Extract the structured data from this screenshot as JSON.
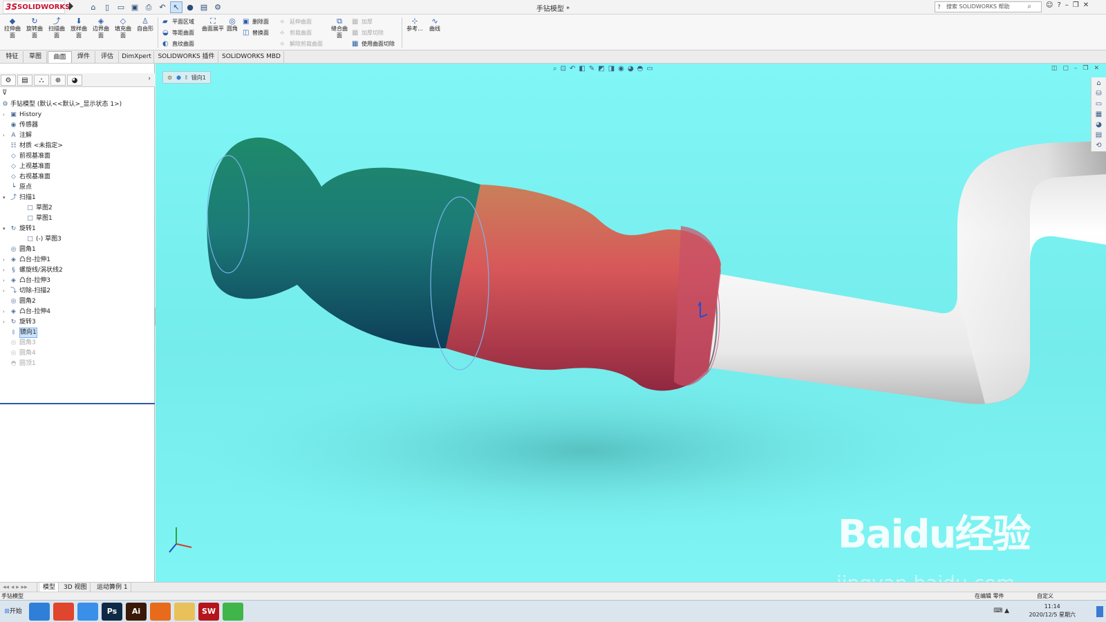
{
  "app": {
    "brand": "SOLIDWORKS",
    "brand_prefix": "3S",
    "doc_title": "手钻模型 *"
  },
  "search": {
    "placeholder": "搜索 SOLIDWORKS 帮助"
  },
  "quick_access": [
    "home-icon",
    "new-icon",
    "open-icon",
    "save-icon",
    "print-icon",
    "undo-icon",
    "select-icon",
    "rebuild-icon",
    "file-props-icon",
    "options-icon"
  ],
  "ribbon": {
    "big_buttons": [
      {
        "label": "拉伸曲面",
        "icon": "extrude-surface-icon"
      },
      {
        "label": "旋转曲面",
        "icon": "revolve-surface-icon"
      },
      {
        "label": "扫描曲面",
        "icon": "sweep-surface-icon"
      },
      {
        "label": "放样曲面",
        "icon": "loft-surface-icon"
      },
      {
        "label": "边界曲面",
        "icon": "boundary-surface-icon"
      },
      {
        "label": "填充曲面",
        "icon": "fill-surface-icon"
      },
      {
        "label": "自由形",
        "icon": "freeform-icon"
      }
    ],
    "col2": [
      "平面区域",
      "等距曲面",
      "直纹曲面"
    ],
    "flatten": "曲面展平",
    "fillet": "圆角",
    "col3": [
      "删除面",
      "替换面"
    ],
    "col4_disabled": [
      "延伸曲面",
      "剪裁曲面",
      "解除剪裁曲面"
    ],
    "knit": "缝合曲面",
    "col5": [
      {
        "label": "加厚",
        "disabled": true
      },
      {
        "label": "加厚切除",
        "disabled": true
      },
      {
        "label": "使用曲面切除",
        "disabled": false
      }
    ],
    "ref": "参考...",
    "curves": "曲线"
  },
  "tabs": [
    {
      "label": "特征",
      "active": false
    },
    {
      "label": "草图",
      "active": false
    },
    {
      "label": "曲面",
      "active": true
    },
    {
      "label": "焊件",
      "active": false
    },
    {
      "label": "评估",
      "active": false
    },
    {
      "label": "DimXpert",
      "active": false
    },
    {
      "label": "SOLIDWORKS 插件",
      "active": false
    },
    {
      "label": "SOLIDWORKS MBD",
      "active": false
    }
  ],
  "tree": {
    "root": "手钻模型 (默认<<默认>_显示状态 1>)",
    "items": [
      {
        "label": "History",
        "icon": "history-icon",
        "indent": 0,
        "arrow": "right"
      },
      {
        "label": "传感器",
        "icon": "sensor-icon",
        "indent": 0,
        "arrow": ""
      },
      {
        "label": "注解",
        "icon": "annotation-icon",
        "indent": 0,
        "arrow": "right"
      },
      {
        "label": "材质 <未指定>",
        "icon": "material-icon",
        "indent": 0,
        "arrow": ""
      },
      {
        "label": "前视基准面",
        "icon": "plane-icon",
        "indent": 0,
        "arrow": ""
      },
      {
        "label": "上视基准面",
        "icon": "plane-icon",
        "indent": 0,
        "arrow": ""
      },
      {
        "label": "右视基准面",
        "icon": "plane-icon",
        "indent": 0,
        "arrow": ""
      },
      {
        "label": "原点",
        "icon": "origin-icon",
        "indent": 0,
        "arrow": ""
      },
      {
        "label": "扫描1",
        "icon": "sweep-icon",
        "indent": 0,
        "arrow": "down"
      },
      {
        "label": "草图2",
        "icon": "sketch-icon",
        "indent": 1,
        "arrow": ""
      },
      {
        "label": "草图1",
        "icon": "sketch-icon",
        "indent": 1,
        "arrow": ""
      },
      {
        "label": "旋转1",
        "icon": "revolve-icon",
        "indent": 0,
        "arrow": "down"
      },
      {
        "label": "(-) 草图3",
        "icon": "sketch-icon",
        "indent": 1,
        "arrow": ""
      },
      {
        "label": "圆角1",
        "icon": "fillet-icon",
        "indent": 0,
        "arrow": ""
      },
      {
        "label": "凸台-拉伸1",
        "icon": "extrude-icon",
        "indent": 0,
        "arrow": "right"
      },
      {
        "label": "螺旋线/涡状线2",
        "icon": "helix-icon",
        "indent": 0,
        "arrow": "right"
      },
      {
        "label": "凸台-拉伸3",
        "icon": "extrude-icon",
        "indent": 0,
        "arrow": "right"
      },
      {
        "label": "切除-扫描2",
        "icon": "cut-sweep-icon",
        "indent": 0,
        "arrow": "right"
      },
      {
        "label": "圆角2",
        "icon": "fillet-icon",
        "indent": 0,
        "arrow": ""
      },
      {
        "label": "凸台-拉伸4",
        "icon": "extrude-icon",
        "indent": 0,
        "arrow": "right"
      },
      {
        "label": "旋转3",
        "icon": "revolve-icon",
        "indent": 0,
        "arrow": "right"
      },
      {
        "label": "镜向1",
        "icon": "mirror-icon",
        "indent": 0,
        "arrow": "",
        "selected": true
      },
      {
        "label": "圆角3",
        "icon": "fillet-icon",
        "indent": 0,
        "arrow": "",
        "suppressed": true
      },
      {
        "label": "圆角4",
        "icon": "fillet-icon",
        "indent": 0,
        "arrow": "",
        "suppressed": true
      },
      {
        "label": "圆顶1",
        "icon": "dome-icon",
        "indent": 0,
        "arrow": "",
        "suppressed": true
      }
    ]
  },
  "breadcrumb": {
    "item": "镜向1"
  },
  "bottom_tabs": [
    {
      "label": "模型",
      "active": true
    },
    {
      "label": "3D 视图",
      "active": false
    },
    {
      "label": "运动算例 1",
      "active": false
    }
  ],
  "status": {
    "left": "手钻模型",
    "editing": "在编辑 零件",
    "units": "自定义"
  },
  "clock": {
    "time": "11:14",
    "date": "2020/12/5 星期六"
  },
  "taskbar": {
    "start": "开始",
    "apps": [
      {
        "name": "browser-icon",
        "glyph": "",
        "color": "#2f7fd8"
      },
      {
        "name": "chrome-icon",
        "glyph": "",
        "color": "#e0452e"
      },
      {
        "name": "baidu-netdisk-icon",
        "glyph": "",
        "color": "#3a8fe8"
      },
      {
        "name": "photoshop-icon",
        "glyph": "Ps",
        "color": "#0f2a44"
      },
      {
        "name": "illustrator-icon",
        "glyph": "Ai",
        "color": "#3a1a06"
      },
      {
        "name": "firefox-icon",
        "glyph": "",
        "color": "#e76b1b"
      },
      {
        "name": "file-explorer-icon",
        "glyph": "",
        "color": "#e8c15a"
      },
      {
        "name": "solidworks-icon",
        "glyph": "SW",
        "color": "#b5141c"
      },
      {
        "name": "wechat-icon",
        "glyph": "",
        "color": "#3fb54a"
      }
    ]
  },
  "watermark": {
    "logo": "Baidu经验",
    "url": "jingyan.baidu.com"
  }
}
